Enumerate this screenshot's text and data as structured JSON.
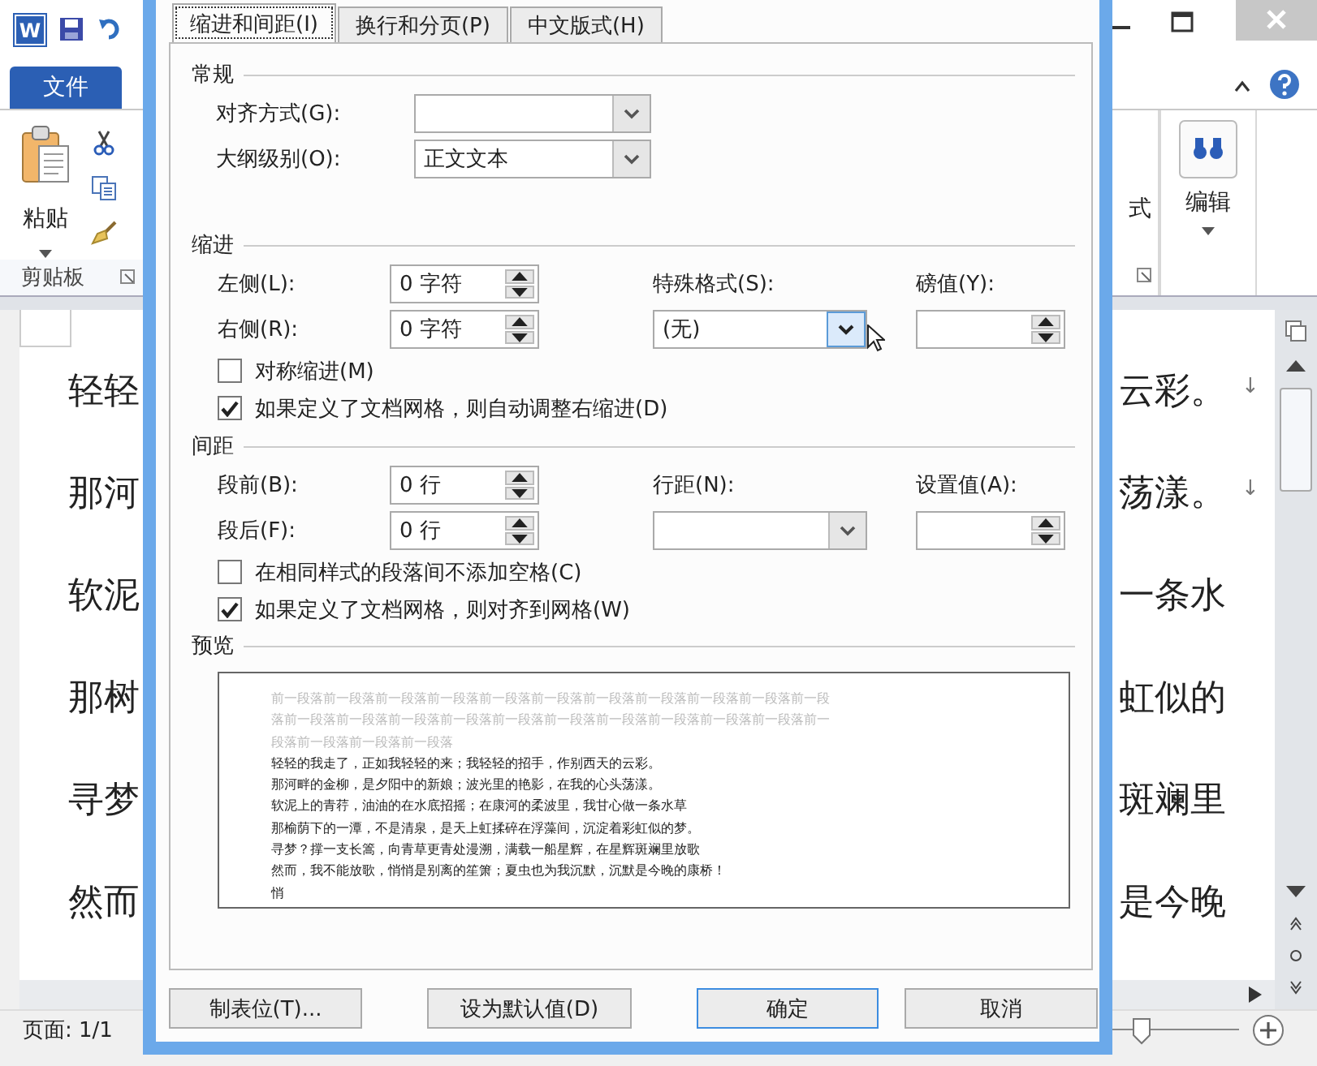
{
  "word_window": {
    "app_icon": "W",
    "file_tab": "文件",
    "paste_label": "粘贴",
    "clipboard_group": "剪贴板",
    "styles_label": "式",
    "edit_label": "编辑",
    "document_lines": [
      {
        "left": "轻轻",
        "right": "云彩。",
        "mark": "↓"
      },
      {
        "left": "那河",
        "right": "荡漾。",
        "mark": "↓"
      },
      {
        "left": "软泥",
        "right": "一条水"
      },
      {
        "left": "那树",
        "right": "虹似的"
      },
      {
        "left": "寻梦",
        "right": "斑斓里"
      },
      {
        "left": "然而",
        "right": "是今晚"
      }
    ],
    "status_bar": {
      "page": "页面: 1/1",
      "zoom_slider": {
        "level": 0.5
      }
    }
  },
  "dialog": {
    "tabs": [
      {
        "label": "缩进和间距(I)",
        "selected": true
      },
      {
        "label": "换行和分页(P)",
        "selected": false
      },
      {
        "label": "中文版式(H)",
        "selected": false
      }
    ],
    "general": {
      "title": "常规",
      "alignment": {
        "label": "对齐方式(G):"
      },
      "outline": {
        "label": "大纲级别(O):",
        "value": "正文文本"
      }
    },
    "indent": {
      "title": "缩进",
      "left": {
        "label": "左侧(L):",
        "value": "0 字符"
      },
      "right": {
        "label": "右侧(R):",
        "value": "0 字符"
      },
      "special": {
        "label": "特殊格式(S):",
        "value": "(无)"
      },
      "by": {
        "label": "磅值(Y):"
      },
      "checkboxes": [
        {
          "label": "对称缩进(M)",
          "checked": false
        },
        {
          "label": "如果定义了文档网格，则自动调整右缩进(D)",
          "checked": true
        }
      ]
    },
    "spacing": {
      "title": "间距",
      "before": {
        "label": "段前(B):",
        "value": "0 行"
      },
      "after": {
        "label": "段后(F):",
        "value": "0 行"
      },
      "line_spacing": {
        "label": "行距(N):"
      },
      "at": {
        "label": "设置值(A):"
      },
      "checkboxes": [
        {
          "label": "在相同样式的段落间不添加空格(C)",
          "checked": false
        },
        {
          "label": "如果定义了文档网格，则对齐到网格(W)",
          "checked": true
        }
      ]
    },
    "preview": {
      "title": "预览",
      "previous_lines": [
        "前一段落前一段落前一段落前一段落前一段落前一段落前一段落前一段落前一段落前一段落前一段",
        "落前一段落前一段落前一段落前一段落前一段落前一段落前一段落前一段落前一段落前一段落前一",
        "段落前一段落前一段落前一段落"
      ],
      "lines": [
        "轻轻的我走了，正如我轻轻的来；我轻轻的招手，作别西天的云彩。",
        "那河畔的金柳，是夕阳中的新娘；波光里的艳影，在我的心头荡漾。",
        "软泥上的青荇，油油的在水底招摇；在康河的柔波里，我甘心做一条水草",
        "那榆荫下的一潭，不是清泉，是天上虹揉碎在浮藻间，沉淀着彩虹似的梦。",
        "寻梦？撑一支长篙，向青草更青处漫溯，满载一船星辉，在星辉斑斓里放歌",
        "然而，我不能放歌，悄悄是别离的笙箫；夏虫也为我沉默，沉默是今晚的康桥！",
        "悄"
      ]
    },
    "buttons": [
      {
        "label": "制表位(T)...",
        "default": false
      },
      {
        "label": "设为默认值(D)",
        "default": false
      },
      {
        "label": "确定",
        "default": true
      },
      {
        "label": "取消",
        "default": false
      }
    ]
  }
}
